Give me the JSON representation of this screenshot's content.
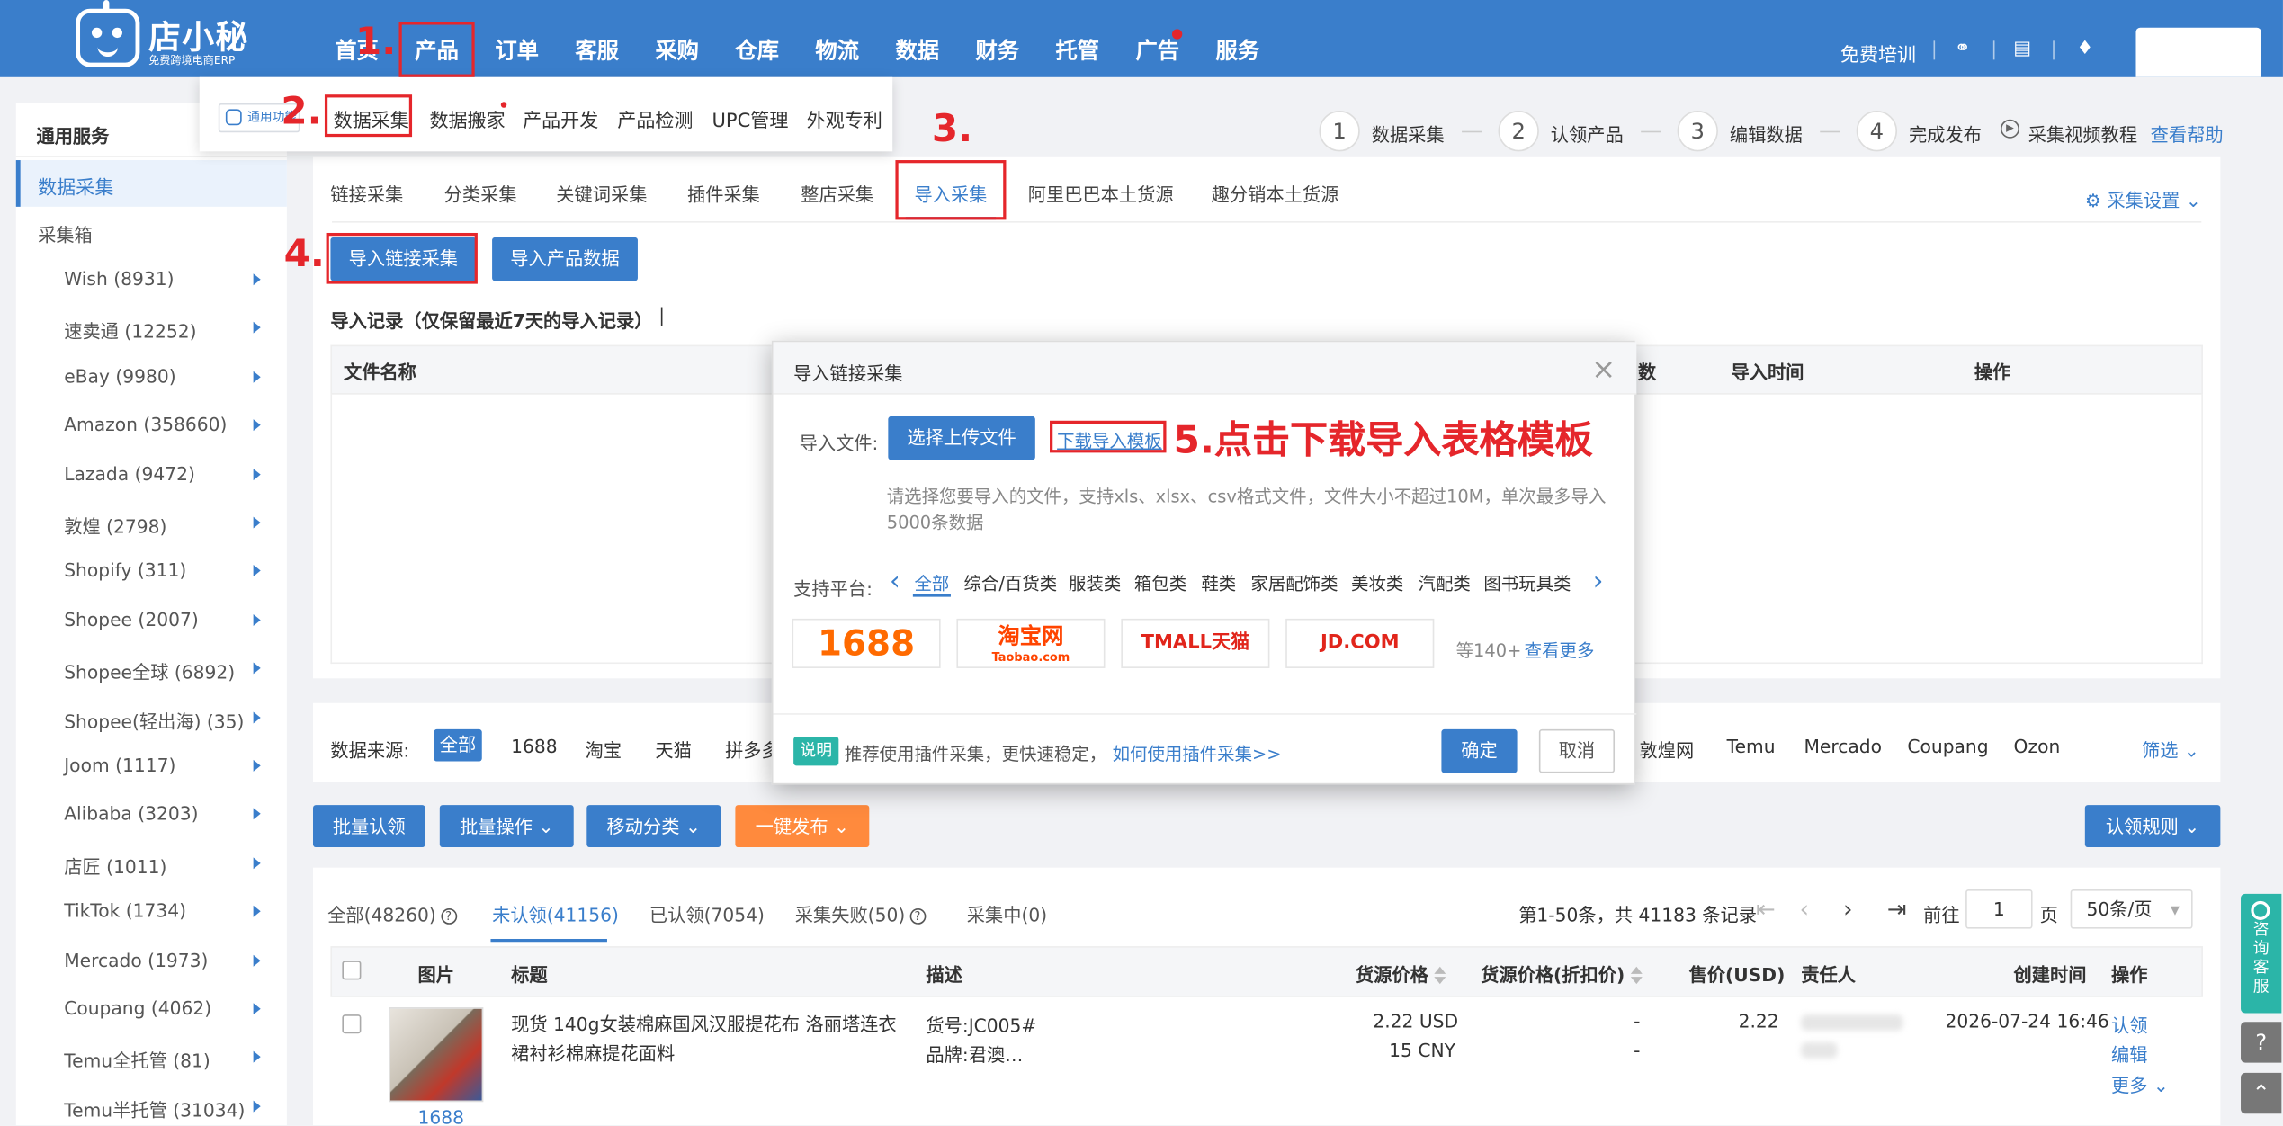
{
  "logo": {
    "name": "店小秘",
    "sub": "免费跨境电商ERP"
  },
  "nav": [
    "首页",
    "产品",
    "订单",
    "客服",
    "采购",
    "仓库",
    "物流",
    "数据",
    "财务",
    "托管",
    "广告",
    "服务"
  ],
  "topright": {
    "training": "免费培训"
  },
  "annotations": {
    "a1": "1.",
    "a2": "2.",
    "a3": "3.",
    "a4": "4.",
    "a5": "5.点击下载导入表格模板"
  },
  "dropdown": {
    "func_label": "通用功能",
    "items": [
      "数据采集",
      "数据搬家",
      "产品开发",
      "产品检测",
      "UPC管理",
      "外观专利"
    ]
  },
  "sidebar": {
    "header": "通用服务",
    "active": "数据采集",
    "box": "采集箱",
    "items": [
      "Wish (8931)",
      "速卖通 (12252)",
      "eBay (9980)",
      "Amazon (358660)",
      "Lazada (9472)",
      "敦煌 (2798)",
      "Shopify (311)",
      "Shopee (2007)",
      "Shopee全球 (6892)",
      "Shopee(轻出海) (35)",
      "Joom (1117)",
      "Alibaba (3203)",
      "店匠 (1011)",
      "TikTok (1734)",
      "Mercado (1973)",
      "Coupang (4062)",
      "Temu全托管 (81)",
      "Temu半托管 (31034)"
    ]
  },
  "steps": [
    {
      "n": "1",
      "t": "数据采集"
    },
    {
      "n": "2",
      "t": "认领产品"
    },
    {
      "n": "3",
      "t": "编辑数据"
    },
    {
      "n": "4",
      "t": "完成发布"
    }
  ],
  "help": {
    "video": "采集视频教程",
    "help": "查看帮助"
  },
  "tabs": [
    "链接采集",
    "分类采集",
    "关键词采集",
    "插件采集",
    "整店采集",
    "导入采集",
    "阿里巴巴本土货源",
    "趣分销本土货源"
  ],
  "settings": "采集设置",
  "import_buttons": {
    "link": "导入链接采集",
    "data": "导入产品数据"
  },
  "import_record": "导入记录（仅保留最近7天的导入记录）",
  "table1_headers": {
    "file": "文件名称",
    "count": "数",
    "time": "导入时间",
    "op": "操作"
  },
  "modal": {
    "title": "导入链接采集",
    "file_label": "导入文件:",
    "upload": "选择上传文件",
    "download": "下载导入模板",
    "hint": "请选择您要导入的文件，支持xls、xlsx、csv格式文件，文件大小不超过10M，单次最多导入5000条数据",
    "platform_label": "支持平台:",
    "categories": [
      "全部",
      "综合/百货类",
      "服装类",
      "箱包类",
      "鞋类",
      "家居配饰类",
      "美妆类",
      "汽配类",
      "图书玩具类"
    ],
    "logos": [
      "1688",
      "淘宝网",
      "TMALL天猫",
      "JD.COM"
    ],
    "logo_sub": "Taobao.com",
    "more_count": "等140+",
    "more": "查看更多",
    "tip_badge": "说明",
    "tip": "推荐使用插件采集，更快速稳定，",
    "tip_link": "如何使用插件采集>>",
    "ok": "确定",
    "cancel": "取消"
  },
  "sources": {
    "label": "数据来源:",
    "active": "全部",
    "items": [
      "1688",
      "淘宝",
      "天猫",
      "拼多多",
      "敦煌网",
      "Temu",
      "Mercado",
      "Coupang",
      "Ozon"
    ],
    "filter": "筛选"
  },
  "actions": {
    "batch_claim": "批量认领",
    "batch_op": "批量操作",
    "move": "移动分类",
    "publish": "一键发布",
    "rules": "认领规则"
  },
  "status_tabs": [
    "全部(48260)",
    "未认领(41156)",
    "已认领(7054)",
    "采集失败(50)",
    "采集中(0)"
  ],
  "pagination": {
    "info": "第1-50条，共 41183 条记录",
    "goto": "前往",
    "page": "1",
    "page_unit": "页",
    "per_page": "50条/页"
  },
  "list_headers": [
    "图片",
    "标题",
    "描述",
    "货源价格",
    "货源价格(折扣价)",
    "售价(USD)",
    "责任人",
    "创建时间",
    "操作"
  ],
  "row": {
    "title": "现货 140g女装棉麻国风汉服提花布 洛丽塔连衣裙衬衫棉麻提花面料",
    "desc1": "货号:JC005#",
    "desc2": "品牌:君澳…",
    "price_usd": "2.22 USD",
    "price_cny": "15 CNY",
    "disc1": "-",
    "disc2": "-",
    "sale": "2.22",
    "created": "2026-07-24 16:46",
    "op1": "认领",
    "op2": "编辑",
    "op3": "更多",
    "source": "1688"
  },
  "float": {
    "consult": "咨询客服"
  }
}
